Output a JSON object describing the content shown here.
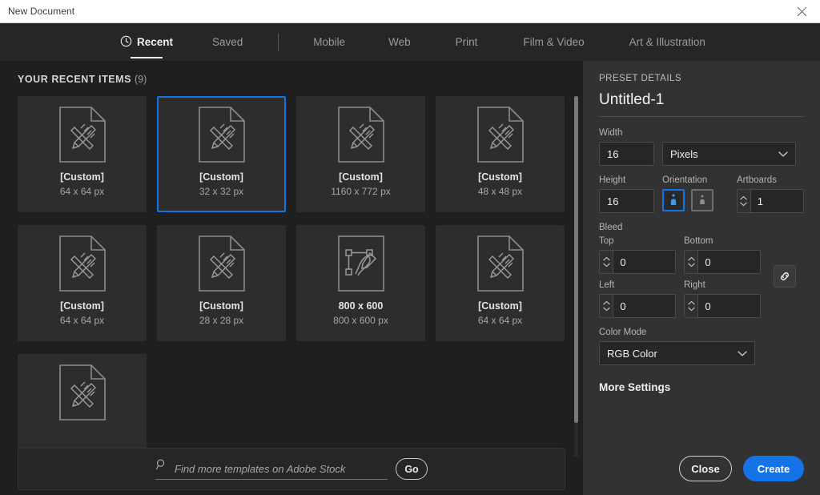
{
  "window": {
    "title": "New Document",
    "close_icon": "close-icon"
  },
  "tabs": [
    {
      "label": "Recent",
      "icon": "clock-icon",
      "active": true
    },
    {
      "label": "Saved",
      "active": false
    },
    {
      "label": "Mobile",
      "active": false
    },
    {
      "label": "Web",
      "active": false
    },
    {
      "label": "Print",
      "active": false
    },
    {
      "label": "Film & Video",
      "active": false
    },
    {
      "label": "Art & Illustration",
      "active": false
    }
  ],
  "recent": {
    "heading": "YOUR RECENT ITEMS",
    "count": "(9)",
    "items": [
      {
        "title": "[Custom]",
        "size": "64 x 64 px",
        "icon": "document-pencil-ruler-icon",
        "selected": false
      },
      {
        "title": "[Custom]",
        "size": "32 x 32 px",
        "icon": "document-pencil-ruler-icon",
        "selected": true
      },
      {
        "title": "[Custom]",
        "size": "1160 x 772 px",
        "icon": "document-pencil-ruler-icon",
        "selected": false
      },
      {
        "title": "[Custom]",
        "size": "48 x 48 px",
        "icon": "document-pencil-ruler-icon",
        "selected": false
      },
      {
        "title": "[Custom]",
        "size": "64 x 64 px",
        "icon": "document-pencil-ruler-icon",
        "selected": false
      },
      {
        "title": "[Custom]",
        "size": "28 x 28 px",
        "icon": "document-pencil-ruler-icon",
        "selected": false
      },
      {
        "title": "800 x 600",
        "size": "800 x 600 px",
        "icon": "pen-path-icon",
        "selected": false
      },
      {
        "title": "[Custom]",
        "size": "64 x 64 px",
        "icon": "document-pencil-ruler-icon",
        "selected": false
      },
      {
        "title": "",
        "size": "",
        "icon": "document-pencil-ruler-icon",
        "selected": false
      }
    ]
  },
  "stock": {
    "placeholder": "Find more templates on Adobe Stock",
    "value": "",
    "search_icon": "search-icon",
    "go_label": "Go"
  },
  "preset": {
    "section_label": "PRESET DETAILS",
    "document_name": "Untitled-1",
    "width_label": "Width",
    "width_value": "16",
    "units_value": "Pixels",
    "height_label": "Height",
    "height_value": "16",
    "orientation_label": "Orientation",
    "orientation_portrait_icon": "orientation-portrait-icon",
    "orientation_landscape_icon": "orientation-landscape-icon",
    "orientation_selected": "portrait",
    "artboards_label": "Artboards",
    "artboards_value": "1",
    "bleed_label": "Bleed",
    "bleed_top_label": "Top",
    "bleed_top_value": "0",
    "bleed_bottom_label": "Bottom",
    "bleed_bottom_value": "0",
    "bleed_left_label": "Left",
    "bleed_left_value": "0",
    "bleed_right_label": "Right",
    "bleed_right_value": "0",
    "bleed_link_icon": "link-chain-icon",
    "color_mode_label": "Color Mode",
    "color_mode_value": "RGB Color",
    "more_settings_label": "More Settings"
  },
  "footer": {
    "close_label": "Close",
    "create_label": "Create"
  },
  "colors": {
    "accent_blue": "#1473e6",
    "panel_bg": "#323232",
    "content_bg": "#1f1f1f",
    "card_bg": "#2d2d2d",
    "tabbar_bg": "#262626"
  }
}
